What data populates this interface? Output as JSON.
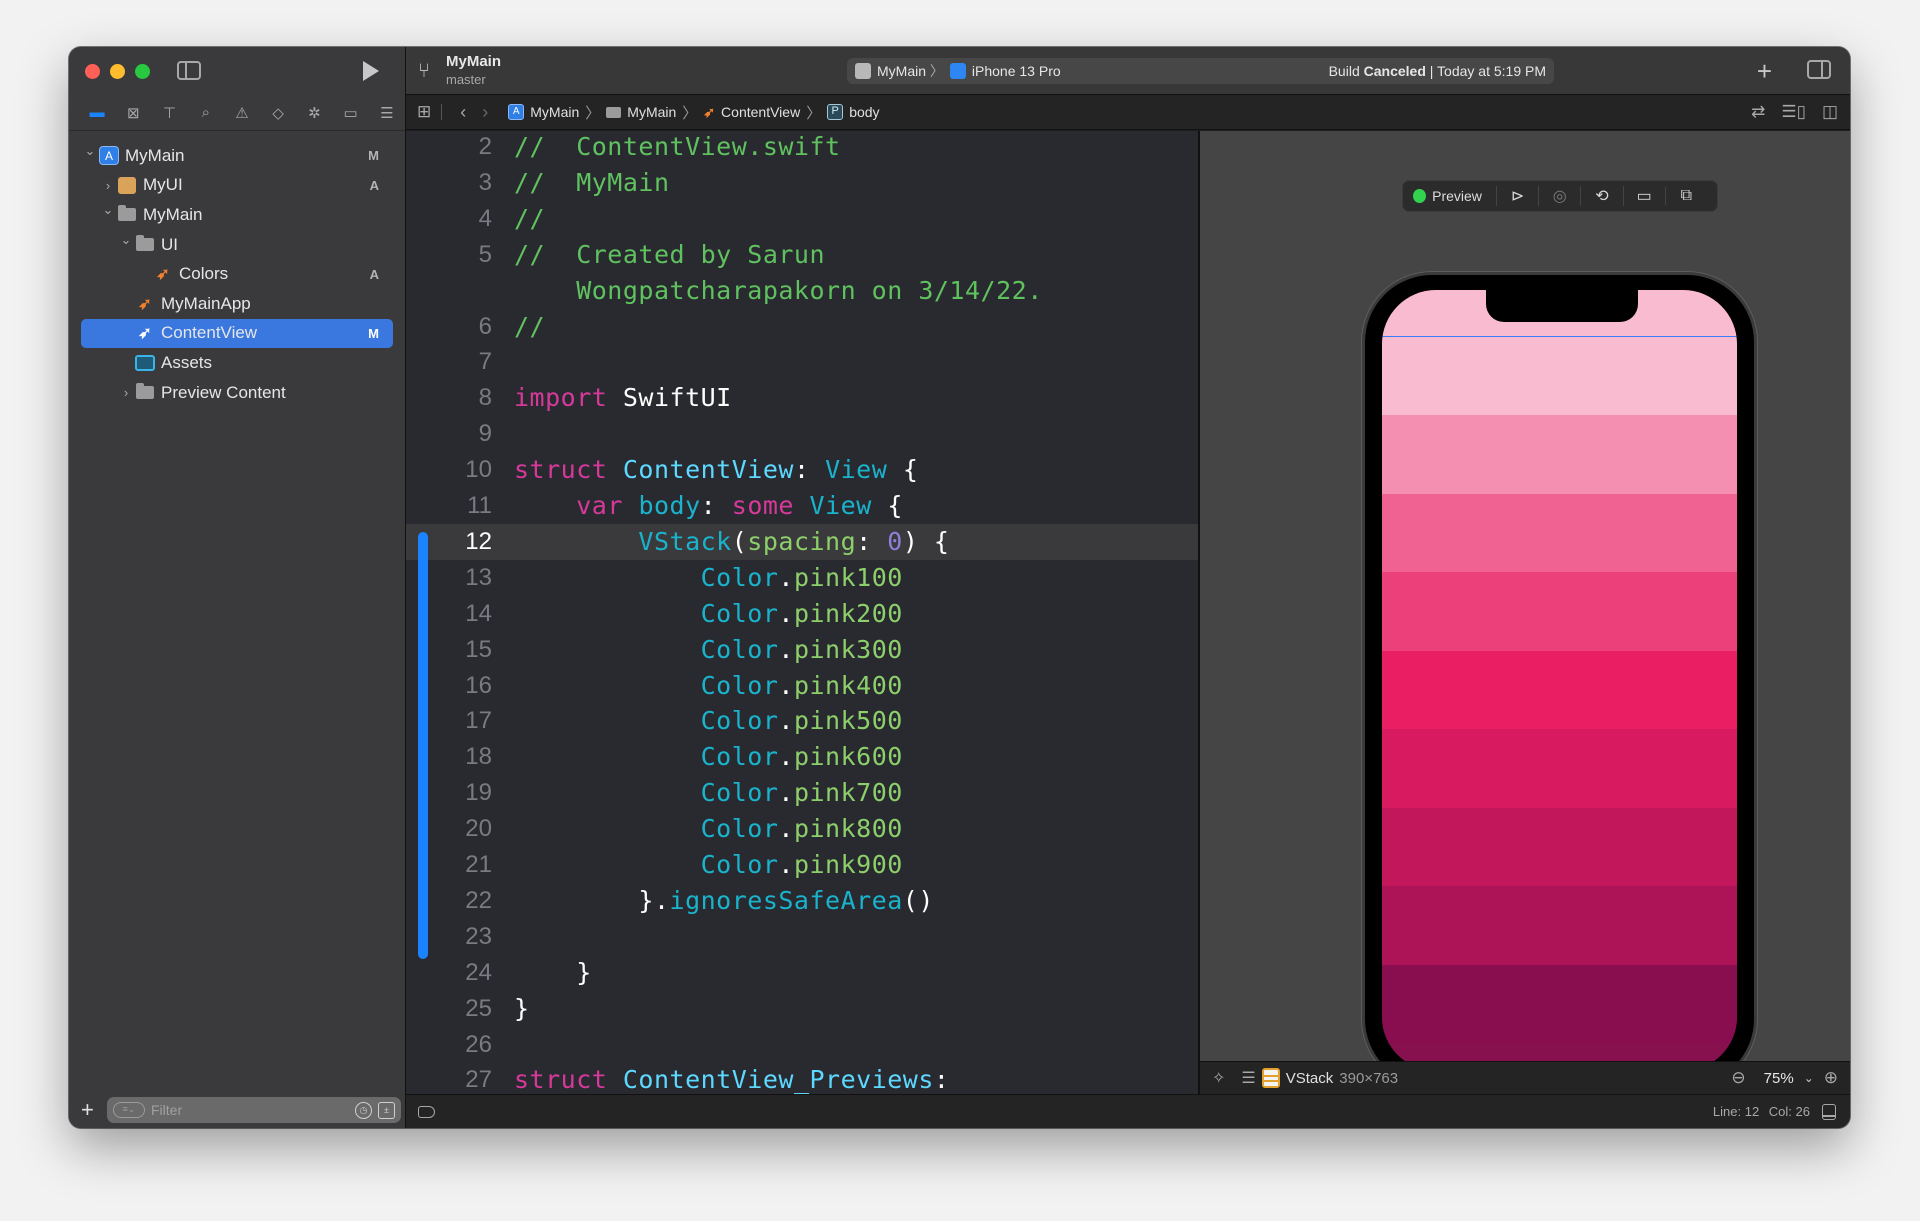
{
  "window": {
    "project_name": "MyMain",
    "branch": "master",
    "scheme": "MyMain",
    "destination": "iPhone 13 Pro",
    "build_status_prefix": "Build",
    "build_status_bold": "Canceled",
    "build_status_time": "| Today at 5:19 PM"
  },
  "navigator_tabs": [
    {
      "icon": "folder-icon",
      "glyph": "▬",
      "active": true
    },
    {
      "icon": "source-control-icon",
      "glyph": "⊠"
    },
    {
      "icon": "symbol-hierarchy-icon",
      "glyph": "⊤"
    },
    {
      "icon": "search-icon",
      "glyph": "⌕"
    },
    {
      "icon": "warning-icon",
      "glyph": "⚠"
    },
    {
      "icon": "test-diamond-icon",
      "glyph": "◇"
    },
    {
      "icon": "debug-spray-icon",
      "glyph": "✲"
    },
    {
      "icon": "breakpoint-icon",
      "glyph": "▭"
    },
    {
      "icon": "report-icon",
      "glyph": "☰"
    }
  ],
  "file_tree": [
    {
      "label": "MyMain",
      "type": "project",
      "depth": 0,
      "expanded": true,
      "badge": "M"
    },
    {
      "label": "MyUI",
      "type": "package",
      "depth": 1,
      "expanded": false,
      "badge": "A"
    },
    {
      "label": "MyMain",
      "type": "folder",
      "depth": 1,
      "expanded": true,
      "badge": ""
    },
    {
      "label": "UI",
      "type": "folder",
      "depth": 2,
      "expanded": true,
      "badge": ""
    },
    {
      "label": "Colors",
      "type": "swift",
      "depth": 3,
      "badge": "A"
    },
    {
      "label": "MyMainApp",
      "type": "swift",
      "depth": 2,
      "badge": ""
    },
    {
      "label": "ContentView",
      "type": "swift",
      "depth": 2,
      "badge": "M",
      "selected": true
    },
    {
      "label": "Assets",
      "type": "assets",
      "depth": 2,
      "badge": ""
    },
    {
      "label": "Preview Content",
      "type": "folder",
      "depth": 2,
      "expanded": false,
      "badge": ""
    }
  ],
  "filter": {
    "placeholder": "Filter",
    "value": ""
  },
  "jumpbar": {
    "crumbs": [
      "MyMain",
      "MyMain",
      "ContentView",
      "body"
    ],
    "symbol_badge": "P"
  },
  "editor": {
    "current_line": 12,
    "lines": [
      {
        "n": "2",
        "tokens": [
          [
            "c-com",
            "//  ContentView.swift"
          ]
        ]
      },
      {
        "n": "3",
        "tokens": [
          [
            "c-com",
            "//  MyMain"
          ]
        ]
      },
      {
        "n": "4",
        "tokens": [
          [
            "c-com",
            "//"
          ]
        ]
      },
      {
        "n": "5",
        "tokens": [
          [
            "c-com",
            "//  Created by Sarun"
          ]
        ]
      },
      {
        "n": "",
        "tokens": [
          [
            "c-com",
            "    Wongpatcharapakorn on 3/14/22."
          ]
        ]
      },
      {
        "n": "6",
        "tokens": [
          [
            "c-com",
            "//"
          ]
        ]
      },
      {
        "n": "7",
        "tokens": []
      },
      {
        "n": "8",
        "tokens": [
          [
            "c-kw",
            "import"
          ],
          [
            "c-plain",
            " SwiftUI"
          ]
        ]
      },
      {
        "n": "9",
        "tokens": []
      },
      {
        "n": "10",
        "tokens": [
          [
            "c-kw",
            "struct"
          ],
          [
            "c-plain",
            " "
          ],
          [
            "c-type",
            "ContentView"
          ],
          [
            "c-plain",
            ": "
          ],
          [
            "c-type2",
            "View"
          ],
          [
            "c-plain",
            " {"
          ]
        ]
      },
      {
        "n": "11",
        "tokens": [
          [
            "c-plain",
            "    "
          ],
          [
            "c-kw",
            "var"
          ],
          [
            "c-plain",
            " "
          ],
          [
            "c-type2",
            "body"
          ],
          [
            "c-plain",
            ": "
          ],
          [
            "c-kw",
            "some"
          ],
          [
            "c-plain",
            " "
          ],
          [
            "c-type2",
            "View"
          ],
          [
            "c-plain",
            " {"
          ]
        ]
      },
      {
        "n": "12",
        "tokens": [
          [
            "c-plain",
            "        "
          ],
          [
            "c-type2",
            "VStack"
          ],
          [
            "c-plain",
            "("
          ],
          [
            "c-fn",
            "spacing"
          ],
          [
            "c-plain",
            ": "
          ],
          [
            "c-num",
            "0"
          ],
          [
            "c-plain",
            ") {"
          ]
        ]
      },
      {
        "n": "13",
        "tokens": [
          [
            "c-plain",
            "            "
          ],
          [
            "c-type2",
            "Color"
          ],
          [
            "c-plain",
            "."
          ],
          [
            "c-fn",
            "pink100"
          ]
        ]
      },
      {
        "n": "14",
        "tokens": [
          [
            "c-plain",
            "            "
          ],
          [
            "c-type2",
            "Color"
          ],
          [
            "c-plain",
            "."
          ],
          [
            "c-fn",
            "pink200"
          ]
        ]
      },
      {
        "n": "15",
        "tokens": [
          [
            "c-plain",
            "            "
          ],
          [
            "c-type2",
            "Color"
          ],
          [
            "c-plain",
            "."
          ],
          [
            "c-fn",
            "pink300"
          ]
        ]
      },
      {
        "n": "16",
        "tokens": [
          [
            "c-plain",
            "            "
          ],
          [
            "c-type2",
            "Color"
          ],
          [
            "c-plain",
            "."
          ],
          [
            "c-fn",
            "pink400"
          ]
        ]
      },
      {
        "n": "17",
        "tokens": [
          [
            "c-plain",
            "            "
          ],
          [
            "c-type2",
            "Color"
          ],
          [
            "c-plain",
            "."
          ],
          [
            "c-fn",
            "pink500"
          ]
        ]
      },
      {
        "n": "18",
        "tokens": [
          [
            "c-plain",
            "            "
          ],
          [
            "c-type2",
            "Color"
          ],
          [
            "c-plain",
            "."
          ],
          [
            "c-fn",
            "pink600"
          ]
        ]
      },
      {
        "n": "19",
        "tokens": [
          [
            "c-plain",
            "            "
          ],
          [
            "c-type2",
            "Color"
          ],
          [
            "c-plain",
            "."
          ],
          [
            "c-fn",
            "pink700"
          ]
        ]
      },
      {
        "n": "20",
        "tokens": [
          [
            "c-plain",
            "            "
          ],
          [
            "c-type2",
            "Color"
          ],
          [
            "c-plain",
            "."
          ],
          [
            "c-fn",
            "pink800"
          ]
        ]
      },
      {
        "n": "21",
        "tokens": [
          [
            "c-plain",
            "            "
          ],
          [
            "c-type2",
            "Color"
          ],
          [
            "c-plain",
            "."
          ],
          [
            "c-fn",
            "pink900"
          ]
        ]
      },
      {
        "n": "22",
        "tokens": [
          [
            "c-plain",
            "        }."
          ],
          [
            "c-type2",
            "ignoresSafeArea"
          ],
          [
            "c-plain",
            "()"
          ]
        ]
      },
      {
        "n": "23",
        "tokens": []
      },
      {
        "n": "24",
        "tokens": [
          [
            "c-plain",
            "    }"
          ]
        ]
      },
      {
        "n": "25",
        "tokens": [
          [
            "c-plain",
            "}"
          ]
        ]
      },
      {
        "n": "26",
        "tokens": []
      },
      {
        "n": "27",
        "tokens": [
          [
            "c-kw",
            "struct"
          ],
          [
            "c-plain",
            " "
          ],
          [
            "c-type",
            "ContentView_Previews"
          ],
          [
            "c-plain",
            ":"
          ]
        ]
      }
    ]
  },
  "preview": {
    "status_label": "Preview",
    "status_color": "#32d14f",
    "buttons": [
      "live-play-icon",
      "device-icon",
      "rotate-icon",
      "device-settings-icon",
      "duplicate-icon"
    ],
    "stripe_colors": [
      "#f8bbd0",
      "#f48fb1",
      "#f06292",
      "#ec407a",
      "#e91e63",
      "#d81b60",
      "#c2185b",
      "#ad1457",
      "#880e4f"
    ],
    "selection_name": "VStack",
    "selection_size": "390×763",
    "zoom": "75%"
  },
  "statusbar": {
    "line": "Line: 12",
    "col": "Col: 26"
  },
  "colors": {
    "accent": "#1a84ff",
    "selection": "#3a78e0"
  }
}
